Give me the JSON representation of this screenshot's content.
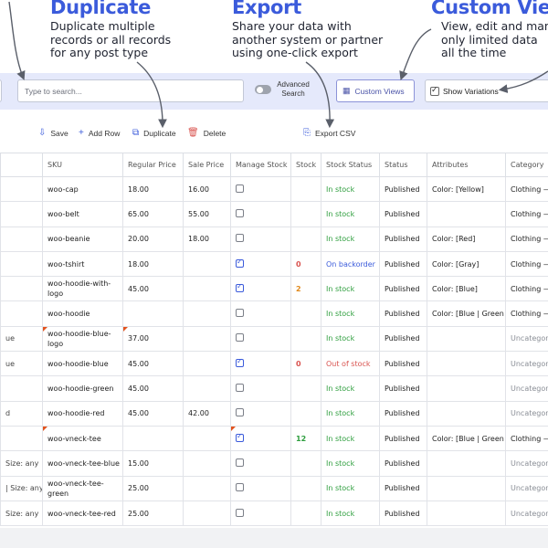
{
  "features": {
    "duplicate": {
      "title": "Duplicate",
      "desc": "Duplicate multiple\nrecords or all records\nfor any post type"
    },
    "export": {
      "title": "Export",
      "desc": "Share your data with\nanother system or partner\nusing one-click export"
    },
    "custom_view": {
      "title": "Custom View",
      "desc": "View, edit and man\nonly limited data\nall the time"
    }
  },
  "toolbar": {
    "search_placeholder": "Type to search...",
    "advanced_search": "Advanced Search",
    "custom_views": "Custom Views",
    "show_variations": "Show Variations"
  },
  "actions": {
    "save": "Save",
    "add_row": "Add Row",
    "duplicate": "Duplicate",
    "delete": "Delete",
    "export_csv": "Export CSV"
  },
  "columns": [
    "",
    "SKU",
    "Regular Price",
    "Sale Price",
    "Manage Stock",
    "Stock",
    "Stock Status",
    "Status",
    "Attributes",
    "Category"
  ],
  "rows": [
    {
      "name": "",
      "sku": "woo-cap",
      "regular": "18.00",
      "sale": "16.00",
      "manage": false,
      "stock": "",
      "stock_status": "In stock",
      "status": "Published",
      "attributes": "Color: [Yellow]",
      "category": "Clothing —"
    },
    {
      "name": "",
      "sku": "woo-belt",
      "regular": "65.00",
      "sale": "55.00",
      "manage": false,
      "stock": "",
      "stock_status": "In stock",
      "status": "Published",
      "attributes": "",
      "category": "Clothing —"
    },
    {
      "name": "",
      "sku": "woo-beanie",
      "regular": "20.00",
      "sale": "18.00",
      "manage": false,
      "stock": "",
      "stock_status": "In stock",
      "status": "Published",
      "attributes": "Color: [Red]",
      "category": "Clothing —"
    },
    {
      "name": "",
      "sku": "woo-tshirt",
      "regular": "18.00",
      "sale": "",
      "manage": true,
      "stock": "0",
      "stock_status": "On backorder",
      "status": "Published",
      "attributes": "Color: [Gray]",
      "category": "Clothing —"
    },
    {
      "name": "",
      "sku": "woo-hoodie-with-logo",
      "regular": "45.00",
      "sale": "",
      "manage": true,
      "stock": "2",
      "stock_status": "In stock",
      "status": "Published",
      "attributes": "Color: [Blue]",
      "category": "Clothing —"
    },
    {
      "name": "",
      "sku": "woo-hoodie",
      "regular": "",
      "sale": "",
      "manage": false,
      "stock": "",
      "stock_status": "In stock",
      "status": "Published",
      "attributes": "Color: [Blue | Green |",
      "category": "Clothing —"
    },
    {
      "name": "ue",
      "sku": "woo-hoodie-blue-logo",
      "regular": "37.00",
      "sale": "",
      "manage": false,
      "stock": "",
      "stock_status": "In stock",
      "status": "Published",
      "attributes": "",
      "category": "Uncategoriz"
    },
    {
      "name": "ue",
      "sku": "woo-hoodie-blue",
      "regular": "45.00",
      "sale": "",
      "manage": true,
      "stock": "0",
      "stock_status": "Out of stock",
      "status": "Published",
      "attributes": "",
      "category": "Uncategoriz"
    },
    {
      "name": "",
      "sku": "woo-hoodie-green",
      "regular": "45.00",
      "sale": "",
      "manage": false,
      "stock": "",
      "stock_status": "In stock",
      "status": "Published",
      "attributes": "",
      "category": "Uncategoriz"
    },
    {
      "name": "d",
      "sku": "woo-hoodie-red",
      "regular": "45.00",
      "sale": "42.00",
      "manage": false,
      "stock": "",
      "stock_status": "In stock",
      "status": "Published",
      "attributes": "",
      "category": "Uncategoriz"
    },
    {
      "name": "",
      "sku": "woo-vneck-tee",
      "regular": "",
      "sale": "",
      "manage": true,
      "stock": "12",
      "stock_status": "In stock",
      "status": "Published",
      "attributes": "Color: [Blue | Green |",
      "category": "Clothing —"
    },
    {
      "name": "Size: any",
      "sku": "woo-vneck-tee-blue",
      "regular": "15.00",
      "sale": "",
      "manage": false,
      "stock": "",
      "stock_status": "In stock",
      "status": "Published",
      "attributes": "",
      "category": "Uncategoriz"
    },
    {
      "name": "| Size: any",
      "sku": "woo-vneck-tee-green",
      "regular": "25.00",
      "sale": "",
      "manage": false,
      "stock": "",
      "stock_status": "In stock",
      "status": "Published",
      "attributes": "",
      "category": "Uncategoriz"
    },
    {
      "name": "Size: any",
      "sku": "woo-vneck-tee-red",
      "regular": "25.00",
      "sale": "",
      "manage": false,
      "stock": "",
      "stock_status": "In stock",
      "status": "Published",
      "attributes": "",
      "category": "Uncategoriz"
    }
  ],
  "colors": {
    "accent": "#3b5bdb",
    "in_stock": "#2e9e3e",
    "out_of_stock": "#d9534f",
    "band": "#e5e9fb"
  }
}
